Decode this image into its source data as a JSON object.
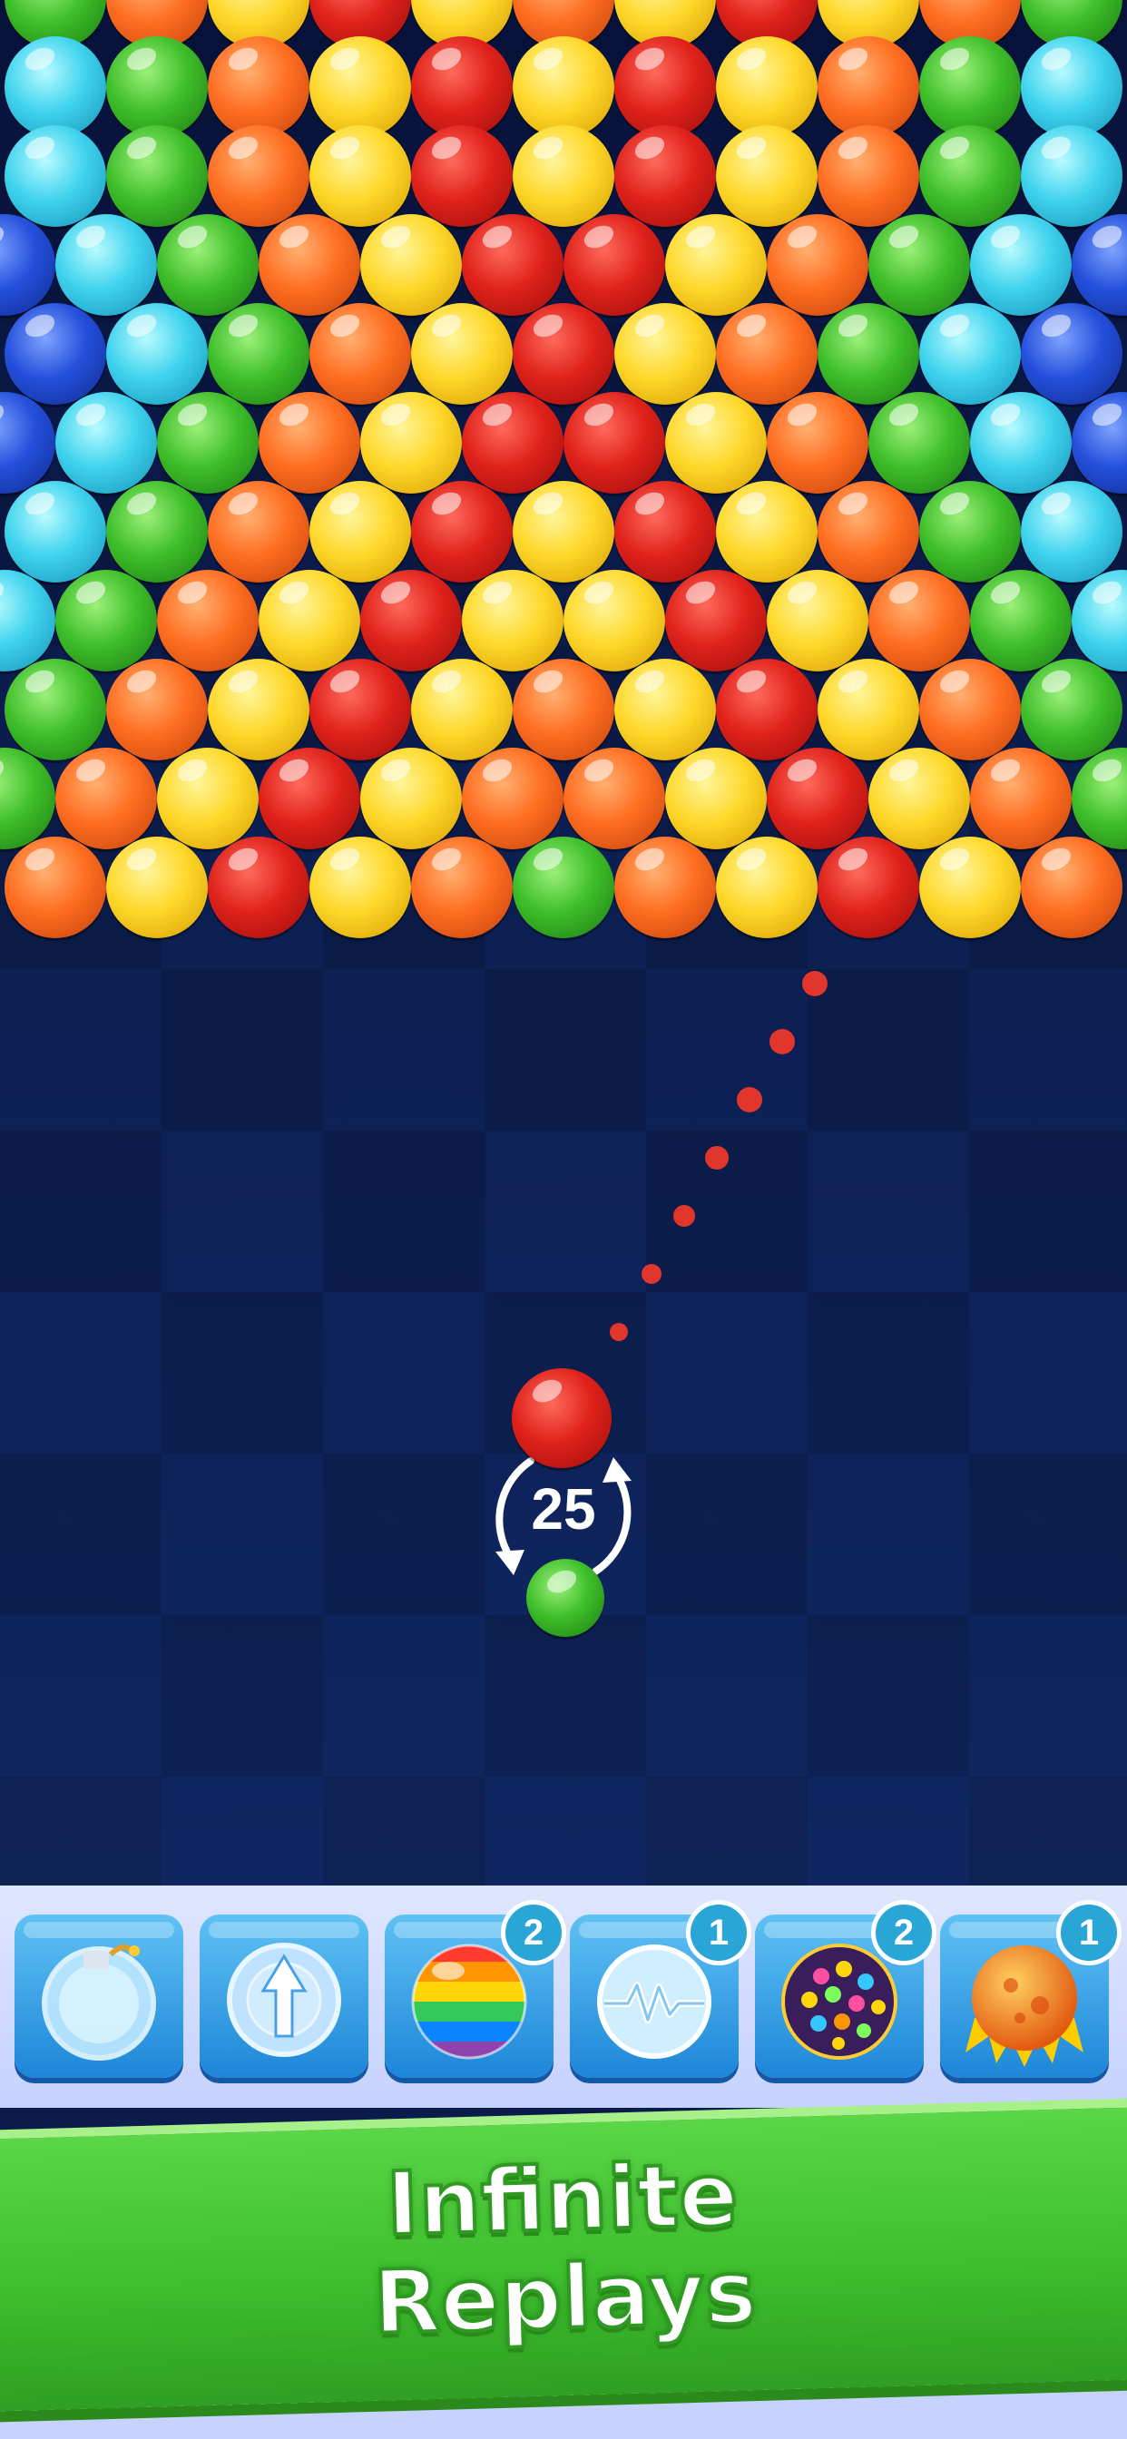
{
  "game": {
    "moves_left": "25",
    "current_bubble": "red",
    "next_bubble": "green",
    "colors": {
      "red": "#e0221b",
      "yellow": "#ffd82a",
      "orange": "#ff6e21",
      "green": "#3fbf2a",
      "cyan": "#3fd3ee",
      "blue": "#2450dc",
      "aim_dot": "#e0362c",
      "banner_green": "#3ebf2e"
    },
    "grid": [
      [
        "green",
        "orange",
        "yellow",
        "red",
        "yellow",
        "orange",
        "yellow",
        "red",
        "yellow",
        "orange",
        "green"
      ],
      [
        "cyan",
        "green",
        "orange",
        "yellow",
        "red",
        "yellow",
        "red",
        "yellow",
        "orange",
        "green",
        "cyan"
      ],
      [
        "cyan",
        "green",
        "orange",
        "yellow",
        "red",
        "yellow",
        "red",
        "yellow",
        "orange",
        "green",
        "cyan"
      ],
      [
        "blue",
        "cyan",
        "green",
        "orange",
        "yellow",
        "red",
        "red",
        "yellow",
        "orange",
        "green",
        "cyan",
        "blue"
      ],
      [
        "blue",
        "cyan",
        "green",
        "orange",
        "yellow",
        "red",
        "yellow",
        "orange",
        "green",
        "cyan",
        "blue"
      ],
      [
        "blue",
        "cyan",
        "green",
        "orange",
        "yellow",
        "red",
        "red",
        "yellow",
        "orange",
        "green",
        "cyan",
        "blue"
      ],
      [
        "cyan",
        "green",
        "orange",
        "yellow",
        "red",
        "yellow",
        "red",
        "yellow",
        "orange",
        "green",
        "cyan"
      ],
      [
        "cyan",
        "green",
        "orange",
        "yellow",
        "red",
        "yellow",
        "yellow",
        "red",
        "yellow",
        "orange",
        "green",
        "cyan"
      ],
      [
        "green",
        "orange",
        "yellow",
        "red",
        "yellow",
        "orange",
        "yellow",
        "red",
        "yellow",
        "orange",
        "green"
      ],
      [
        "green",
        "orange",
        "yellow",
        "red",
        "yellow",
        "orange",
        "orange",
        "yellow",
        "red",
        "yellow",
        "orange",
        "green"
      ],
      [
        "orange",
        "yellow",
        "red",
        "yellow",
        "orange",
        "green",
        "orange",
        "yellow",
        "red",
        "yellow",
        "orange"
      ]
    ]
  },
  "powerups": [
    {
      "icon": "bomb-bubble-icon",
      "count": ""
    },
    {
      "icon": "arrow-bubble-icon",
      "count": ""
    },
    {
      "icon": "rainbow-ball-icon",
      "count": "2"
    },
    {
      "icon": "lightning-bubble-icon",
      "count": "1"
    },
    {
      "icon": "disco-ball-icon",
      "count": "2"
    },
    {
      "icon": "fireball-icon",
      "count": "1"
    }
  ],
  "banner": {
    "line1": "Infinite",
    "line2": "Replays"
  }
}
